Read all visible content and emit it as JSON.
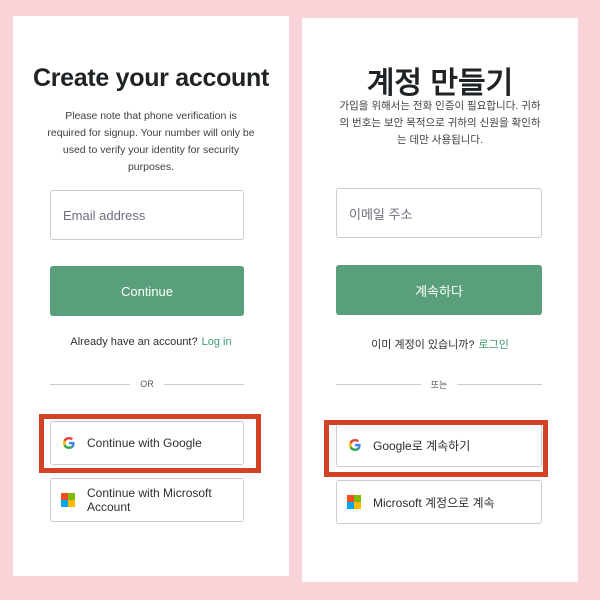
{
  "english": {
    "title": "Create your account",
    "description": "Please note that phone verification is required for signup. Your number will only be used to verify your identity for security purposes.",
    "email_placeholder": "Email address",
    "continue_label": "Continue",
    "have_account_text": "Already have an account?",
    "login_link": "Log in",
    "divider_text": "OR",
    "google_label": "Continue with Google",
    "microsoft_label": "Continue with Microsoft Account"
  },
  "korean": {
    "title": "계정 만들기",
    "description": "가입을 위해서는 전화 인증이 필요합니다. 귀하의 번호는 보안 목적으로 귀하의 신원을 확인하는 데만 사용됩니다.",
    "email_placeholder": "이메일 주소",
    "continue_label": "계속하다",
    "have_account_text": "이미 계정이 있습니까?",
    "login_link": "로그인",
    "divider_text": "또는",
    "google_label": "Google로 계속하기",
    "microsoft_label": "Microsoft 계정으로 계속"
  },
  "colors": {
    "background": "#f8d3d7",
    "primary_button": "#5a9f7c",
    "link": "#3f9b6e",
    "highlight": "#d24325"
  },
  "icons": {
    "google": "google-g-icon",
    "microsoft": "microsoft-logo-icon"
  }
}
